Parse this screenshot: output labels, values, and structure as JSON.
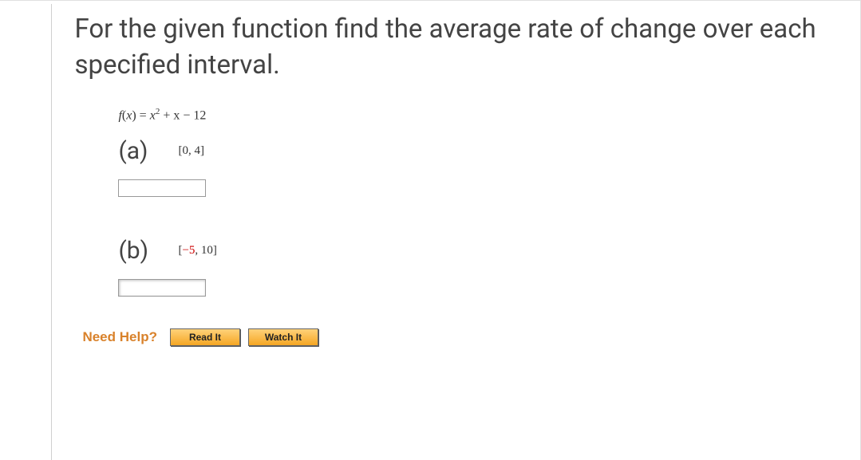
{
  "question": {
    "prompt": "For the given function find the average rate of change over each specified interval.",
    "formula_prefix": "f",
    "formula_arg": "x",
    "formula_equals": " = ",
    "formula_body_var": "x",
    "formula_body_exp": "2",
    "formula_body_rest": " + x − 12"
  },
  "parts": {
    "a": {
      "label": "(a)",
      "interval_open": "[0, ",
      "interval_mid": "4",
      "interval_close": "]",
      "input_value": ""
    },
    "b": {
      "label": "(b)",
      "interval_open": "[",
      "interval_neg": "−5",
      "interval_mid": ", 10",
      "interval_close": "]",
      "input_value": ""
    }
  },
  "help": {
    "label": "Need Help?",
    "read": "Read It",
    "watch": "Watch It"
  }
}
